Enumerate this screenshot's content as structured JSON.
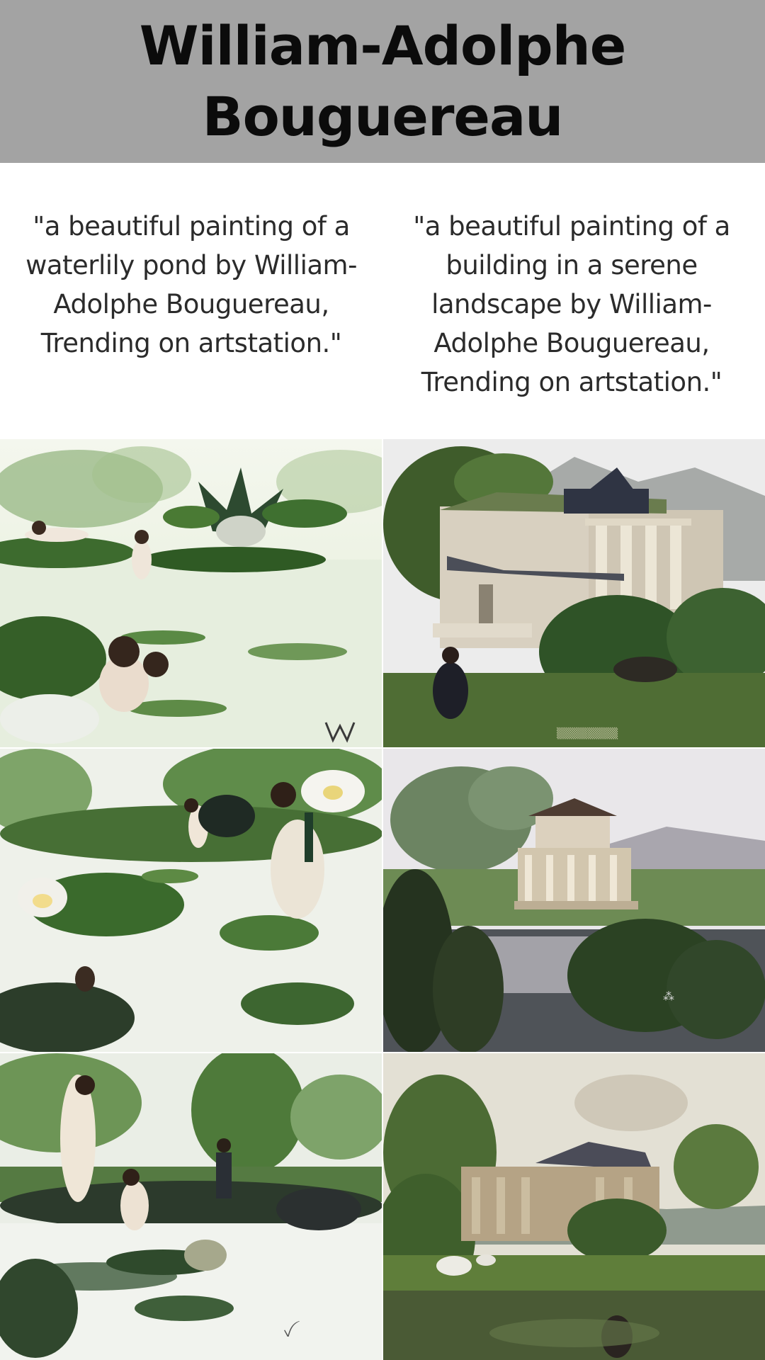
{
  "header": {
    "title_line1": "William-Adolphe",
    "title_line2": "Bouguereau",
    "background_color": "#a3a3a3"
  },
  "prompts": {
    "left": "\"a beautiful painting of a waterlily pond by William-Adolphe Bouguereau, Trending on artstation.\"",
    "right": "\"a beautiful painting of a building in a serene landscape by William-Adolphe Bouguereau, Trending on artstation.\""
  },
  "images": [
    {
      "subject": "waterlily pond with bathers and large water lily flower",
      "column": "left",
      "row": 1
    },
    {
      "subject": "classical white building with columns and mountains",
      "column": "right",
      "row": 1
    },
    {
      "subject": "waterlily pond with women, children and white lotus flowers",
      "column": "left",
      "row": 2
    },
    {
      "subject": "small temple-like building reflected in a lake",
      "column": "right",
      "row": 2
    },
    {
      "subject": "woman and children among lily pads in green pond",
      "column": "left",
      "row": 3
    },
    {
      "subject": "pavilion with columns, sheep and pond under cloudy sky",
      "column": "right",
      "row": 3
    }
  ]
}
